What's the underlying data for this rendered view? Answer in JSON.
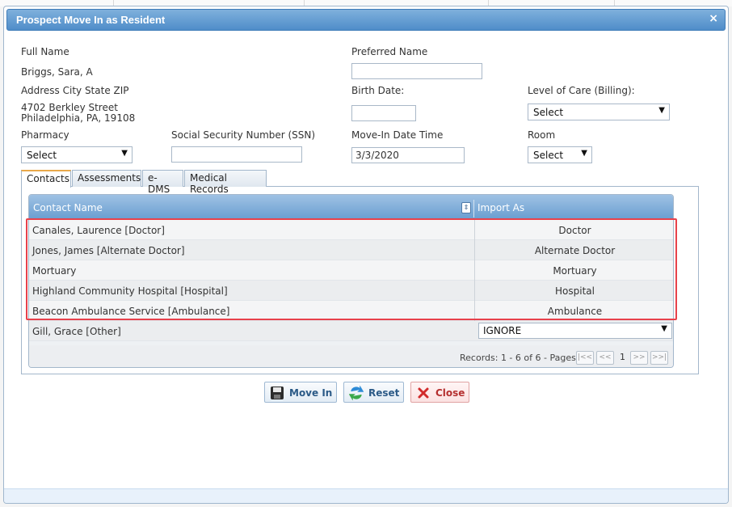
{
  "dialog": {
    "title": "Prospect Move In as Resident",
    "close_glyph": "×"
  },
  "form": {
    "full_name_label": "Full Name",
    "full_name_value": "Briggs, Sara, A",
    "preferred_name_label": "Preferred Name",
    "preferred_name_value": "",
    "address_label": "Address City State ZIP",
    "address_line1": "4702 Berkley Street",
    "address_line2": "Philadelphia, PA, 19108",
    "birth_date_label": "Birth Date:",
    "birth_date_value": "",
    "level_of_care_label": "Level of Care (Billing):",
    "level_of_care_value": "Select",
    "pharmacy_label": "Pharmacy",
    "pharmacy_value": "Select",
    "ssn_label": "Social Security Number (SSN)",
    "ssn_value": "",
    "move_in_label": "Move-In Date Time",
    "move_in_value": "3/3/2020",
    "room_label": "Room",
    "room_value": "Select"
  },
  "tabs": [
    {
      "label": "Contacts",
      "active": true
    },
    {
      "label": "Assessments",
      "active": false
    },
    {
      "label": "e-DMS",
      "active": false
    },
    {
      "label": "Medical Records",
      "active": false
    }
  ],
  "grid": {
    "columns": [
      "Contact Name",
      "Import As"
    ],
    "rows": [
      {
        "name": "Canales, Laurence [Doctor]",
        "import_as": "Doctor"
      },
      {
        "name": "Jones, James [Alternate Doctor]",
        "import_as": "Alternate Doctor"
      },
      {
        "name": "Mortuary",
        "import_as": "Mortuary"
      },
      {
        "name": "Highland Community Hospital [Hospital]",
        "import_as": "Hospital"
      },
      {
        "name": "Beacon Ambulance Service [Ambulance]",
        "import_as": "Ambulance"
      },
      {
        "name": "Gill, Grace [Other]",
        "import_as": "IGNORE"
      }
    ],
    "pager": {
      "records_text": "Records: 1 - 6 of 6 - Pages:",
      "page": "1"
    }
  },
  "buttons": {
    "move_in": "Move In",
    "reset": "Reset",
    "close": "Close"
  },
  "colors": {
    "title_bar": "#4f8dc9",
    "highlight": "#e8414b"
  }
}
